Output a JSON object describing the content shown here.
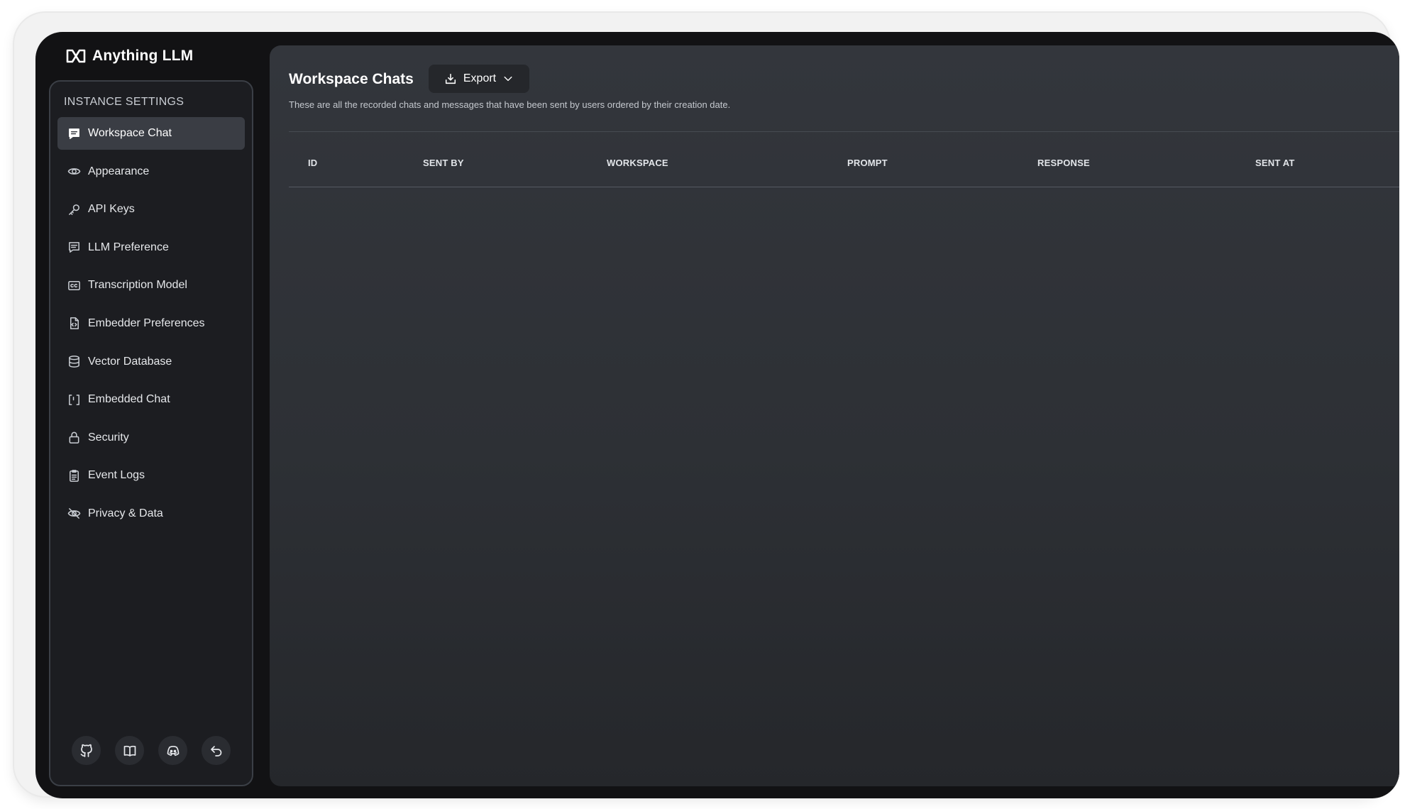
{
  "app": {
    "name": "Anything LLM"
  },
  "sidebar": {
    "section_title": "INSTANCE SETTINGS",
    "items": [
      {
        "label": "Workspace Chat",
        "icon": "chat-icon",
        "active": true
      },
      {
        "label": "Appearance",
        "icon": "eye-icon",
        "active": false
      },
      {
        "label": "API Keys",
        "icon": "key-icon",
        "active": false
      },
      {
        "label": "LLM Preference",
        "icon": "message-square-icon",
        "active": false
      },
      {
        "label": "Transcription Model",
        "icon": "closed-caption-icon",
        "active": false
      },
      {
        "label": "Embedder Preferences",
        "icon": "file-code-icon",
        "active": false
      },
      {
        "label": "Vector Database",
        "icon": "database-icon",
        "active": false
      },
      {
        "label": "Embedded Chat",
        "icon": "code-brackets-icon",
        "active": false
      },
      {
        "label": "Security",
        "icon": "lock-icon",
        "active": false
      },
      {
        "label": "Event Logs",
        "icon": "clipboard-list-icon",
        "active": false
      },
      {
        "label": "Privacy & Data",
        "icon": "eye-slash-icon",
        "active": false
      }
    ],
    "footer_icons": [
      "github-icon",
      "book-icon",
      "discord-icon",
      "undo-icon"
    ]
  },
  "main": {
    "title": "Workspace Chats",
    "export_label": "Export",
    "subtitle": "These are all the recorded chats and messages that have been sent by users ordered by their creation date.",
    "columns": [
      "ID",
      "SENT BY",
      "WORKSPACE",
      "PROMPT",
      "RESPONSE",
      "SENT AT"
    ],
    "rows": []
  },
  "colors": {
    "screen_bg": "#121214",
    "sidebar_bg": "#1c1d21",
    "main_bg": "#2d3035",
    "active_item_bg": "#3a3d44",
    "text": "#ffffff"
  }
}
